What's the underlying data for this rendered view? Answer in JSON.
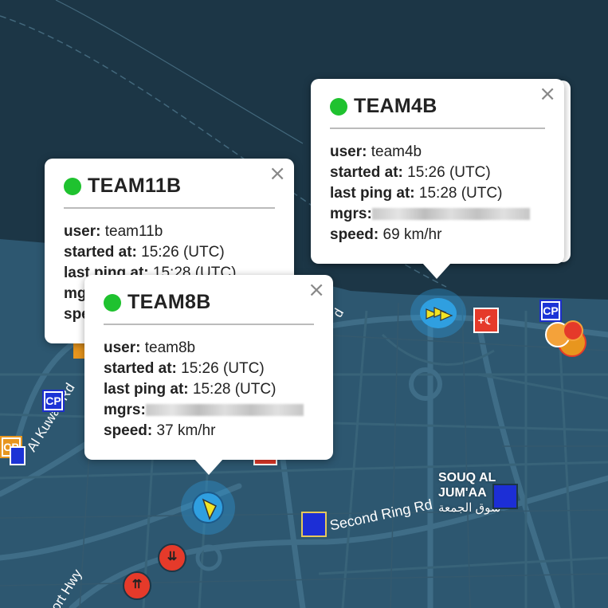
{
  "popups": {
    "team11b": {
      "name": "TEAM11B",
      "user_label": "user:",
      "user": "team11b",
      "started_label": "started at:",
      "started": "15:26 (UTC)",
      "ping_label": "last ping at:",
      "ping": "15:28 (UTC)",
      "mgrs_label": "mgrs:",
      "speed_label": "spe"
    },
    "team8b": {
      "name": "TEAM8B",
      "user_label": "user:",
      "user": "team8b",
      "started_label": "started at:",
      "started": "15:26 (UTC)",
      "ping_label": "last ping at:",
      "ping": "15:28 (UTC)",
      "mgrs_label": "mgrs:",
      "speed_label": "speed:",
      "speed": "37 km/hr"
    },
    "team4b": {
      "name": "TEAM4B",
      "user_label": "user:",
      "user": "team4b",
      "started_label": "started at:",
      "started": "15:26 (UTC)",
      "ping_label": "last ping at:",
      "ping": "15:28 (UTC)",
      "mgrs_label": "mgrs:",
      "speed_label": "speed:",
      "speed": "69 km/hr"
    },
    "close_symbol": "×",
    "status_color": "#1fc22f"
  },
  "map_labels": {
    "road_kuwait": "Al Kuwait Rd",
    "second_ring": "Second Ring Rd",
    "port_hwy": "ort Hwy",
    "road_d": "d",
    "souq_line1": "SOUQ AL",
    "souq_line2": "JUM'AA",
    "souq_arabic": "سوق الجمعة"
  },
  "markers": {
    "cp_label": "CP",
    "icons": [
      "checkpoint-icon",
      "hospital-icon",
      "team-location-icon",
      "incident-icon",
      "square-marker-icon"
    ]
  },
  "colors": {
    "sea": "#1c3646",
    "land": "#2d5770",
    "road": "#3e6b84",
    "team_marker": "#2f9fe0",
    "checkpoint": "#1c33d6",
    "hospital": "#e53a2a"
  }
}
